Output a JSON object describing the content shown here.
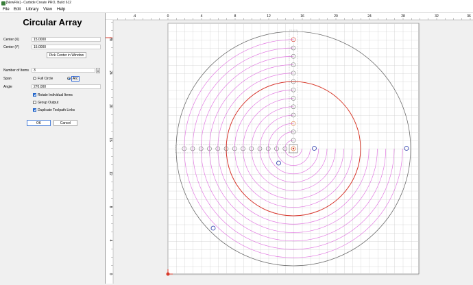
{
  "window": {
    "title": "[NewFile] - Carbide Create PRO, Build 612"
  },
  "menu": [
    "File",
    "Edit",
    "Library",
    "View",
    "Help"
  ],
  "dialog": {
    "heading": "Circular Array",
    "center_x": {
      "label": "Center (X)",
      "value": "15.0000"
    },
    "center_y": {
      "label": "Center (Y)",
      "value": "15.0000"
    },
    "pick_center_label": "Pick Center in Window",
    "num_items": {
      "label": "Number of Items",
      "value": "3"
    },
    "span": {
      "label": "Span",
      "option_full": "Full Circle",
      "option_arc": "Arc",
      "selected": "Arc"
    },
    "angle": {
      "label": "Angle",
      "value": "270.000"
    },
    "rotate_items": {
      "label": "Rotate Individual Items",
      "checked": true
    },
    "group_output": {
      "label": "Group Output",
      "checked": false
    },
    "duplicate_links": {
      "label": "Duplicate Toolpath Links",
      "checked": true
    },
    "ok_label": "OK",
    "cancel_label": "Cancel"
  },
  "ruler": {
    "x_ticks": [
      "-4",
      "0",
      "4",
      "8",
      "12",
      "16",
      "20",
      "24",
      "28",
      "32",
      "36"
    ],
    "y_ticks": [
      "28",
      "24",
      "20",
      "16",
      "12",
      "8",
      "4",
      "0"
    ]
  },
  "canvas": {
    "colors": {
      "grid": "#cfcfcf",
      "stock": "#ffffff",
      "pink": "#e27ae2",
      "red": "#d83a2a",
      "gray": "#6e6e6e",
      "blue": "#1f2fa8",
      "orange": "#e07a3a"
    }
  }
}
